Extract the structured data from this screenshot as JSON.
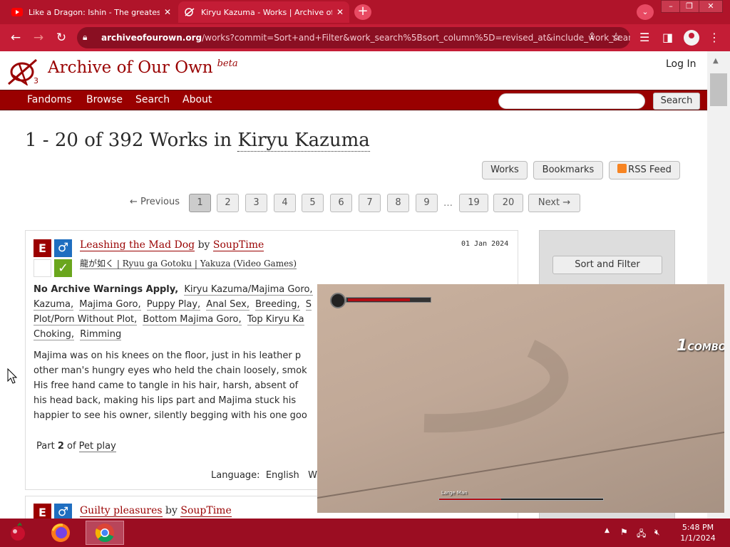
{
  "browser": {
    "tabs": [
      {
        "title": "Like a Dragon: Ishin - The greatest",
        "favicon": "youtube-icon"
      },
      {
        "title": "Kiryu Kazuma - Works | Archive of Our Own",
        "favicon": "ao3-icon"
      }
    ],
    "new_tab": "+",
    "url": {
      "host": "archiveofourown.org",
      "path": "/works?commit=Sort+and+Filter&work_search%5Bsort_column%5D=revised_at&include_work_search%5Bcate..."
    },
    "accent_color": "#c41d36"
  },
  "site": {
    "name": "Archive of Our Own",
    "beta": "beta",
    "login": "Log In",
    "nav": [
      "Fandoms",
      "Browse",
      "Search",
      "About"
    ],
    "search_button": "Search"
  },
  "heading": {
    "prefix": "1 - 20 of 392 Works in",
    "tag": "Kiryu Kazuma"
  },
  "actions": [
    "Works",
    "Bookmarks",
    "RSS Feed"
  ],
  "pagination": {
    "previous": "← Previous",
    "pages": [
      "1",
      "2",
      "3",
      "4",
      "5",
      "6",
      "7",
      "8",
      "9"
    ],
    "gap": "…",
    "tail": [
      "19",
      "20"
    ],
    "next": "Next →",
    "current": "1"
  },
  "work1": {
    "rating": "E",
    "category": "♂",
    "warning": "",
    "complete": "✓",
    "title": "Leashing the Mad Dog",
    "by": "by",
    "author": "SoupTime",
    "fandoms": "龍が如く | Ryuu ga Gotoku | Yakuza (Video Games)",
    "date": "01 Jan 2024",
    "warning_tag": "No Archive Warnings Apply,",
    "tags_line1": [
      "Kiryu Kazuma/Majima Goro,"
    ],
    "tags_line2": [
      "Kazuma,",
      "Majima Goro,",
      "Puppy Play,",
      "Anal Sex,",
      "Breeding,",
      "S"
    ],
    "tags_line3": [
      "Plot/Porn Without Plot,",
      "Bottom Majima Goro,",
      "Top Kiryu Ka"
    ],
    "tags_line4": [
      "Choking,",
      "Rimming"
    ],
    "summary": [
      "Majima was on his knees on the floor, just in his leather p",
      "other man's hungry eyes who held the chain loosely, smok",
      "His free hand came to tangle in his hair, harsh, absent of",
      "his head back, making his lips part and Majima stuck his",
      "happier to see his owner, silently begging with his one goo"
    ],
    "series": {
      "part": "Part",
      "number": "2",
      "of": "of",
      "name": "Pet play"
    },
    "language_label": "Language:",
    "language": "English",
    "words_label": "W"
  },
  "work2": {
    "rating": "E",
    "category": "♂",
    "title": "Guilty pleasures",
    "by": "by",
    "author": "SoupTime"
  },
  "sidebar": {
    "sort_filter": "Sort and Filter"
  },
  "video": {
    "combo_count": "1",
    "combo_label": "COMBO",
    "enemy_label": "Large Man",
    "player_health": 0.75,
    "enemy_health": 0.38
  },
  "taskbar": {
    "time": "5:48 PM",
    "date": "1/1/2024",
    "pinned": [
      "app-icon",
      "firefox-icon",
      "chrome-icon"
    ]
  }
}
